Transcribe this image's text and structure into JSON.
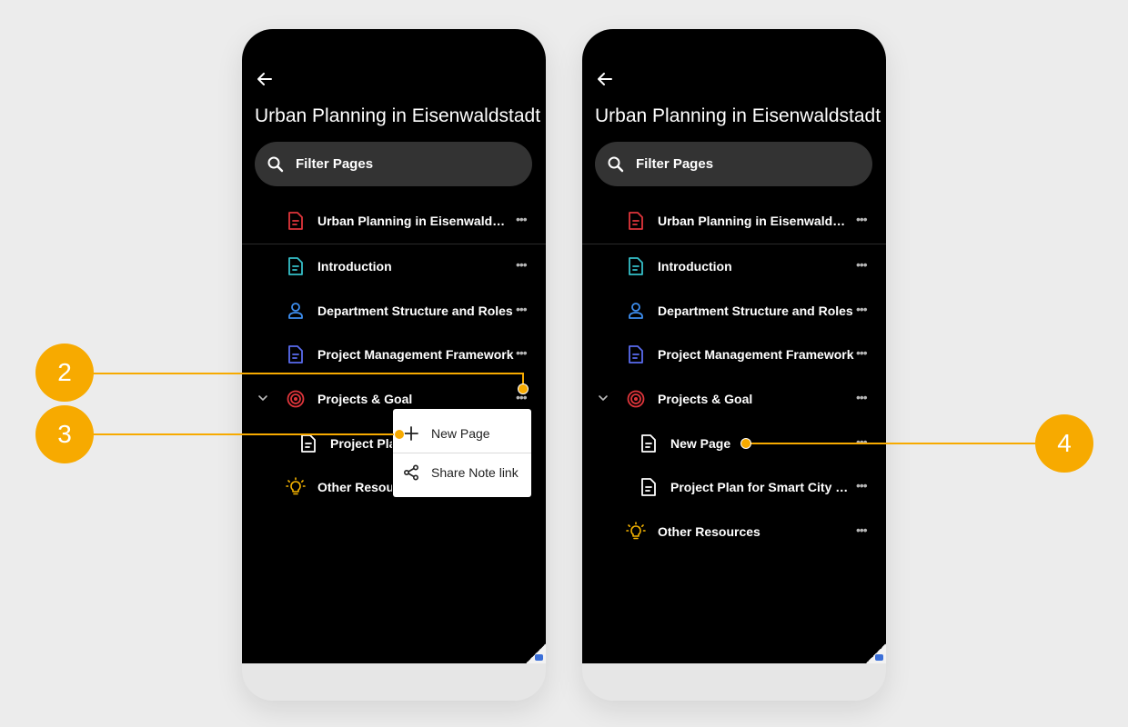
{
  "screens": [
    {
      "title": "Urban Planning in Eisenwaldstadt",
      "search_placeholder": "Filter Pages",
      "items": [
        {
          "label": "Urban Planning in Eisenwaldstadt",
          "icon": "document-red-icon"
        },
        {
          "label": "Introduction",
          "icon": "document-teal-icon"
        },
        {
          "label": "Department Structure and Roles",
          "icon": "person-icon"
        },
        {
          "label": "Project Management Framework",
          "icon": "document-blue-icon"
        },
        {
          "label": "Projects & Goal",
          "icon": "target-icon"
        },
        {
          "label": "Project Plan for Smart City Initiative",
          "icon": "document-white-icon"
        },
        {
          "label": "Other Resources",
          "icon": "lightbulb-icon"
        }
      ],
      "context_menu": [
        {
          "label": "New Page",
          "icon": "plus-icon"
        },
        {
          "label": "Share Note link",
          "icon": "share-icon"
        }
      ]
    },
    {
      "title": "Urban Planning in Eisenwaldstadt",
      "search_placeholder": "Filter Pages",
      "items": [
        {
          "label": "Urban Planning in Eisenwaldstadt",
          "icon": "document-red-icon"
        },
        {
          "label": "Introduction",
          "icon": "document-teal-icon"
        },
        {
          "label": "Department Structure and Roles",
          "icon": "person-icon"
        },
        {
          "label": "Project Management Framework",
          "icon": "document-blue-icon"
        },
        {
          "label": "Projects & Goal",
          "icon": "target-icon"
        },
        {
          "label": "New Page",
          "icon": "document-white-icon"
        },
        {
          "label": "Project Plan for Smart City Initiative",
          "icon": "document-white-icon"
        },
        {
          "label": "Other Resources",
          "icon": "lightbulb-icon"
        }
      ]
    }
  ],
  "callouts": [
    "2",
    "3",
    "4"
  ],
  "more_glyph": "•••",
  "colors": {
    "accent": "#f7aa00",
    "background": "#000000",
    "search": "#333333"
  }
}
